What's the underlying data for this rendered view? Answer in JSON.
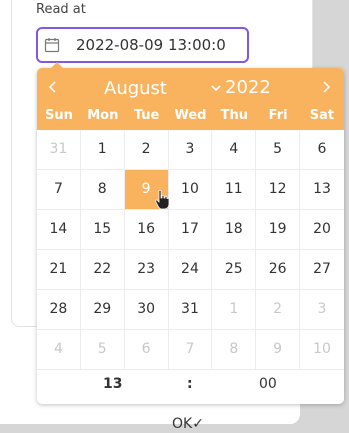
{
  "field": {
    "label": "Read at",
    "value": "2022-08-09 13:00:0"
  },
  "calendar": {
    "month": "August",
    "year": "2022",
    "weekdays": [
      "Sun",
      "Mon",
      "Tue",
      "Wed",
      "Thu",
      "Fri",
      "Sat"
    ],
    "weeks": [
      [
        "31",
        "1",
        "2",
        "3",
        "4",
        "5",
        "6"
      ],
      [
        "7",
        "8",
        "9",
        "10",
        "11",
        "12",
        "13"
      ],
      [
        "14",
        "15",
        "16",
        "17",
        "18",
        "19",
        "20"
      ],
      [
        "21",
        "22",
        "23",
        "24",
        "25",
        "26",
        "27"
      ],
      [
        "28",
        "29",
        "30",
        "31",
        "1",
        "2",
        "3"
      ],
      [
        "4",
        "5",
        "6",
        "7",
        "8",
        "9",
        "10"
      ]
    ],
    "selected_day": "9",
    "accent_color": "#f9b35e"
  },
  "time": {
    "hours": "13",
    "separator": ":",
    "minutes": "00"
  },
  "ok_label": "OK✓",
  "icons": [
    "calendar-icon",
    "chevron-left-icon",
    "chevron-right-icon",
    "chevron-down-icon",
    "pointer-cursor-icon"
  ]
}
